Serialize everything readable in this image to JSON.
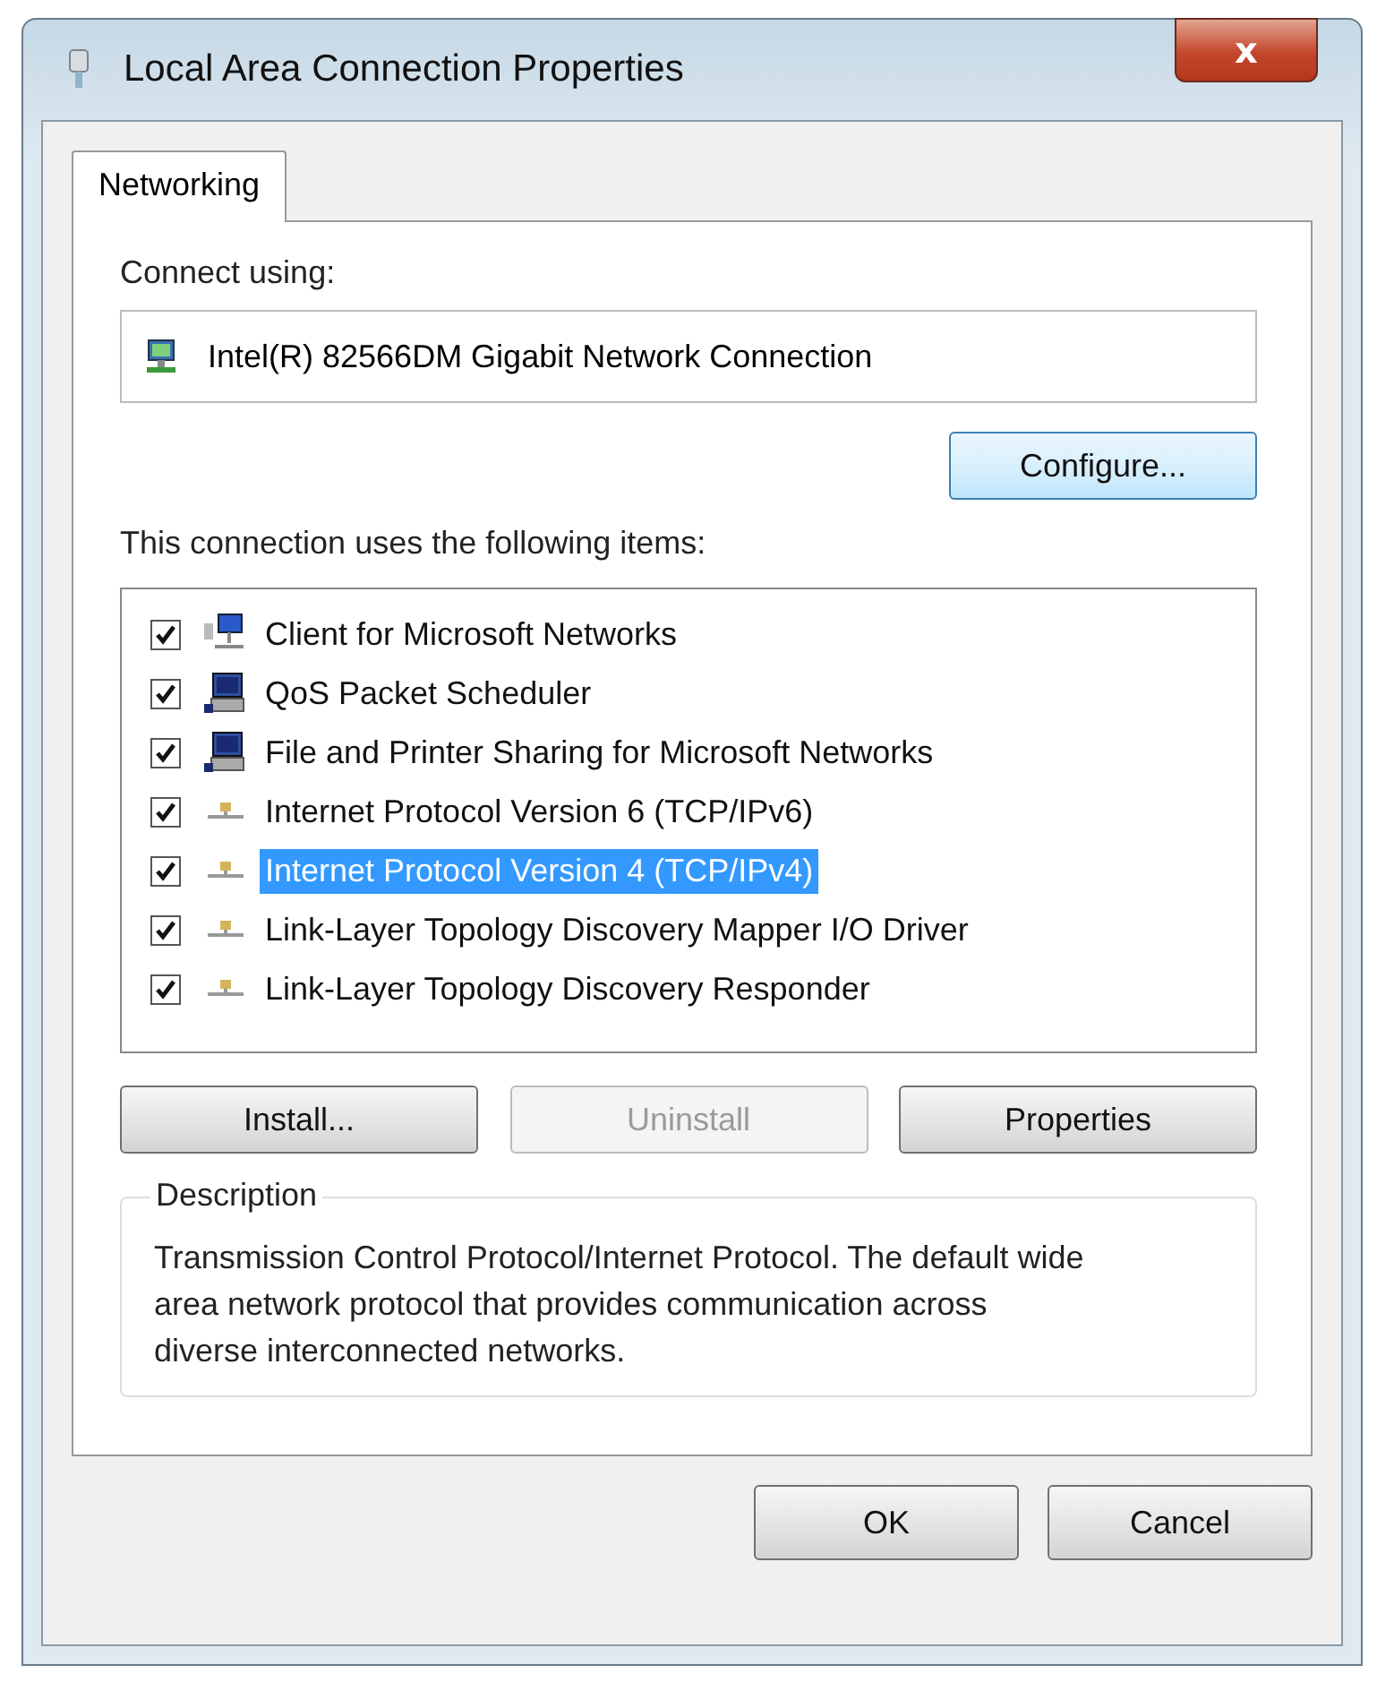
{
  "window": {
    "title": "Local Area Connection Properties",
    "close": "x"
  },
  "tabs": [
    {
      "label": "Networking",
      "selected": true
    }
  ],
  "connect_using": {
    "label": "Connect using:",
    "adapter": "Intel(R) 82566DM Gigabit Network Connection"
  },
  "configure_button": {
    "label": "Configure...",
    "disabled": false
  },
  "items_label": "This connection uses the following items:",
  "items": [
    {
      "kind": "client",
      "label": "Client for Microsoft Networks",
      "checked": true,
      "selected": false
    },
    {
      "kind": "service",
      "label": "QoS Packet Scheduler",
      "checked": true,
      "selected": false
    },
    {
      "kind": "service",
      "label": "File and Printer Sharing for Microsoft Networks",
      "checked": true,
      "selected": false
    },
    {
      "kind": "protocol",
      "label": "Internet Protocol Version 6 (TCP/IPv6)",
      "checked": true,
      "selected": false
    },
    {
      "kind": "protocol",
      "label": "Internet Protocol Version 4 (TCP/IPv4)",
      "checked": true,
      "selected": true
    },
    {
      "kind": "protocol",
      "label": "Link-Layer Topology Discovery Mapper I/O Driver",
      "checked": true,
      "selected": false
    },
    {
      "kind": "protocol",
      "label": "Link-Layer Topology Discovery Responder",
      "checked": true,
      "selected": false
    }
  ],
  "item_buttons": [
    {
      "label": "Install...",
      "disabled": false
    },
    {
      "label": "Uninstall",
      "disabled": true
    },
    {
      "label": "Properties",
      "disabled": false
    }
  ],
  "description": {
    "title": "Description",
    "text": "Transmission Control Protocol/Internet Protocol. The default wide area network protocol that provides communication across diverse interconnected networks."
  },
  "dialog_buttons": [
    {
      "label": "OK",
      "disabled": false
    },
    {
      "label": "Cancel",
      "disabled": false
    }
  ]
}
